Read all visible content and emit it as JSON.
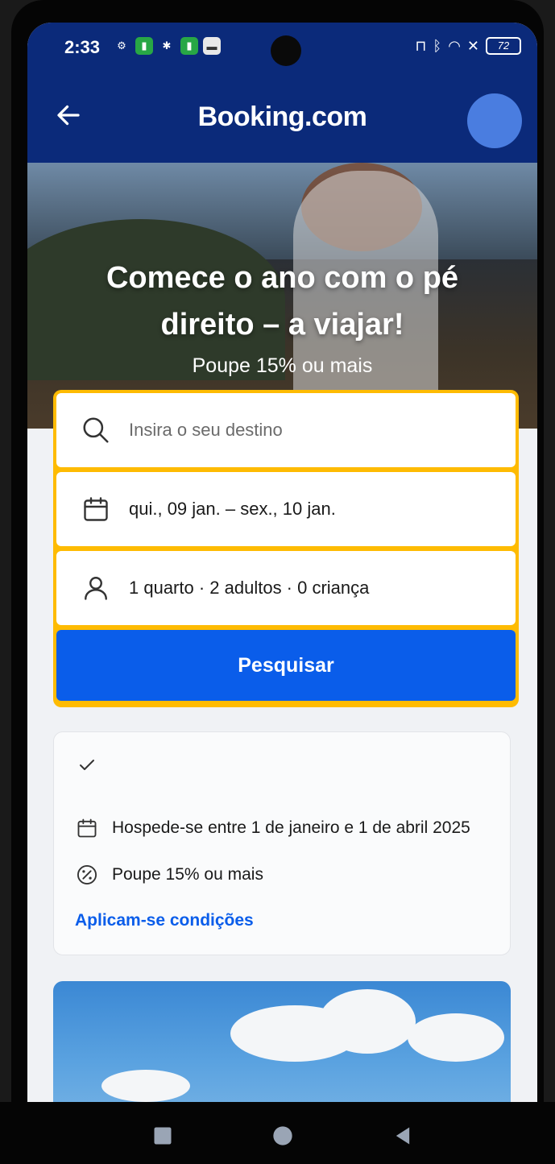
{
  "status_bar": {
    "time": "2:33",
    "battery": "72"
  },
  "app_bar": {
    "brand": "Booking.com"
  },
  "hero": {
    "title": "Comece o ano com o pé direito – a viajar!",
    "subtitle": "Poupe 15% ou mais"
  },
  "search": {
    "destination_placeholder": "Insira o seu destino",
    "dates": "qui., 09 jan. – sex., 10 jan.",
    "occupancy": "1 quarto · 2 adultos · 0 criança",
    "button_label": "Pesquisar"
  },
  "promo": {
    "stay_text": "Hospede-se entre 1 de janeiro e 1 de abril 2025",
    "discount_text": "Poupe 15% ou mais",
    "conditions_link": "Aplicam-se condições"
  },
  "colors": {
    "brand_blue": "#0b2a7a",
    "accent_yellow": "#febb02",
    "button_blue": "#0a5dea"
  },
  "icons": {
    "back": "arrow-left-icon",
    "account": "avatar",
    "search": "search-icon",
    "calendar": "calendar-icon",
    "person": "person-icon",
    "check": "check-icon",
    "percent": "percent-icon"
  }
}
